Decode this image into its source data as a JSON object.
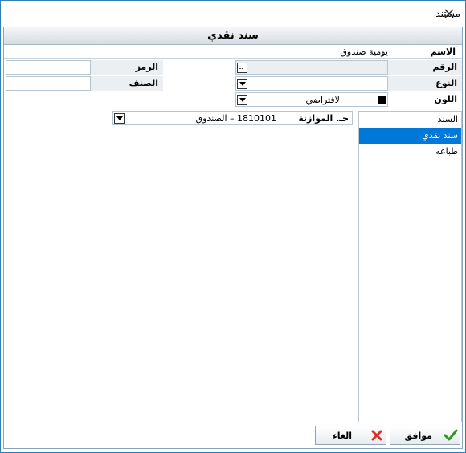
{
  "window": {
    "title": "مستند",
    "close_label": "×"
  },
  "header": {
    "title": "سند نقدي"
  },
  "form": {
    "name_label": "الاسم",
    "name_value": "يومية صندوق",
    "number_label": "الرقم",
    "code_label": "الرمز",
    "type_label": "النوع",
    "class_label": "الصنف",
    "color_label": "اللون",
    "color_value": "الافتراضي",
    "ellipsis": "...",
    "balance_label": "حـ. الموازنة",
    "balance_value": "1810101 – الصندوق"
  },
  "list": {
    "items": [
      {
        "label": "السند",
        "selected": false
      },
      {
        "label": "سند نقدي",
        "selected": true
      },
      {
        "label": "طباعه",
        "selected": false
      }
    ]
  },
  "buttons": {
    "ok": "موافق",
    "cancel": "الغاء"
  },
  "colors": {
    "accent": "#0078d7",
    "border": "#2d7fb8",
    "ok_icon": "#2e9a1e",
    "cancel_icon": "#d9302c"
  },
  "icons": [
    "close-icon",
    "ellipsis-icon",
    "chevron-down-icon",
    "check-icon",
    "x-icon"
  ]
}
